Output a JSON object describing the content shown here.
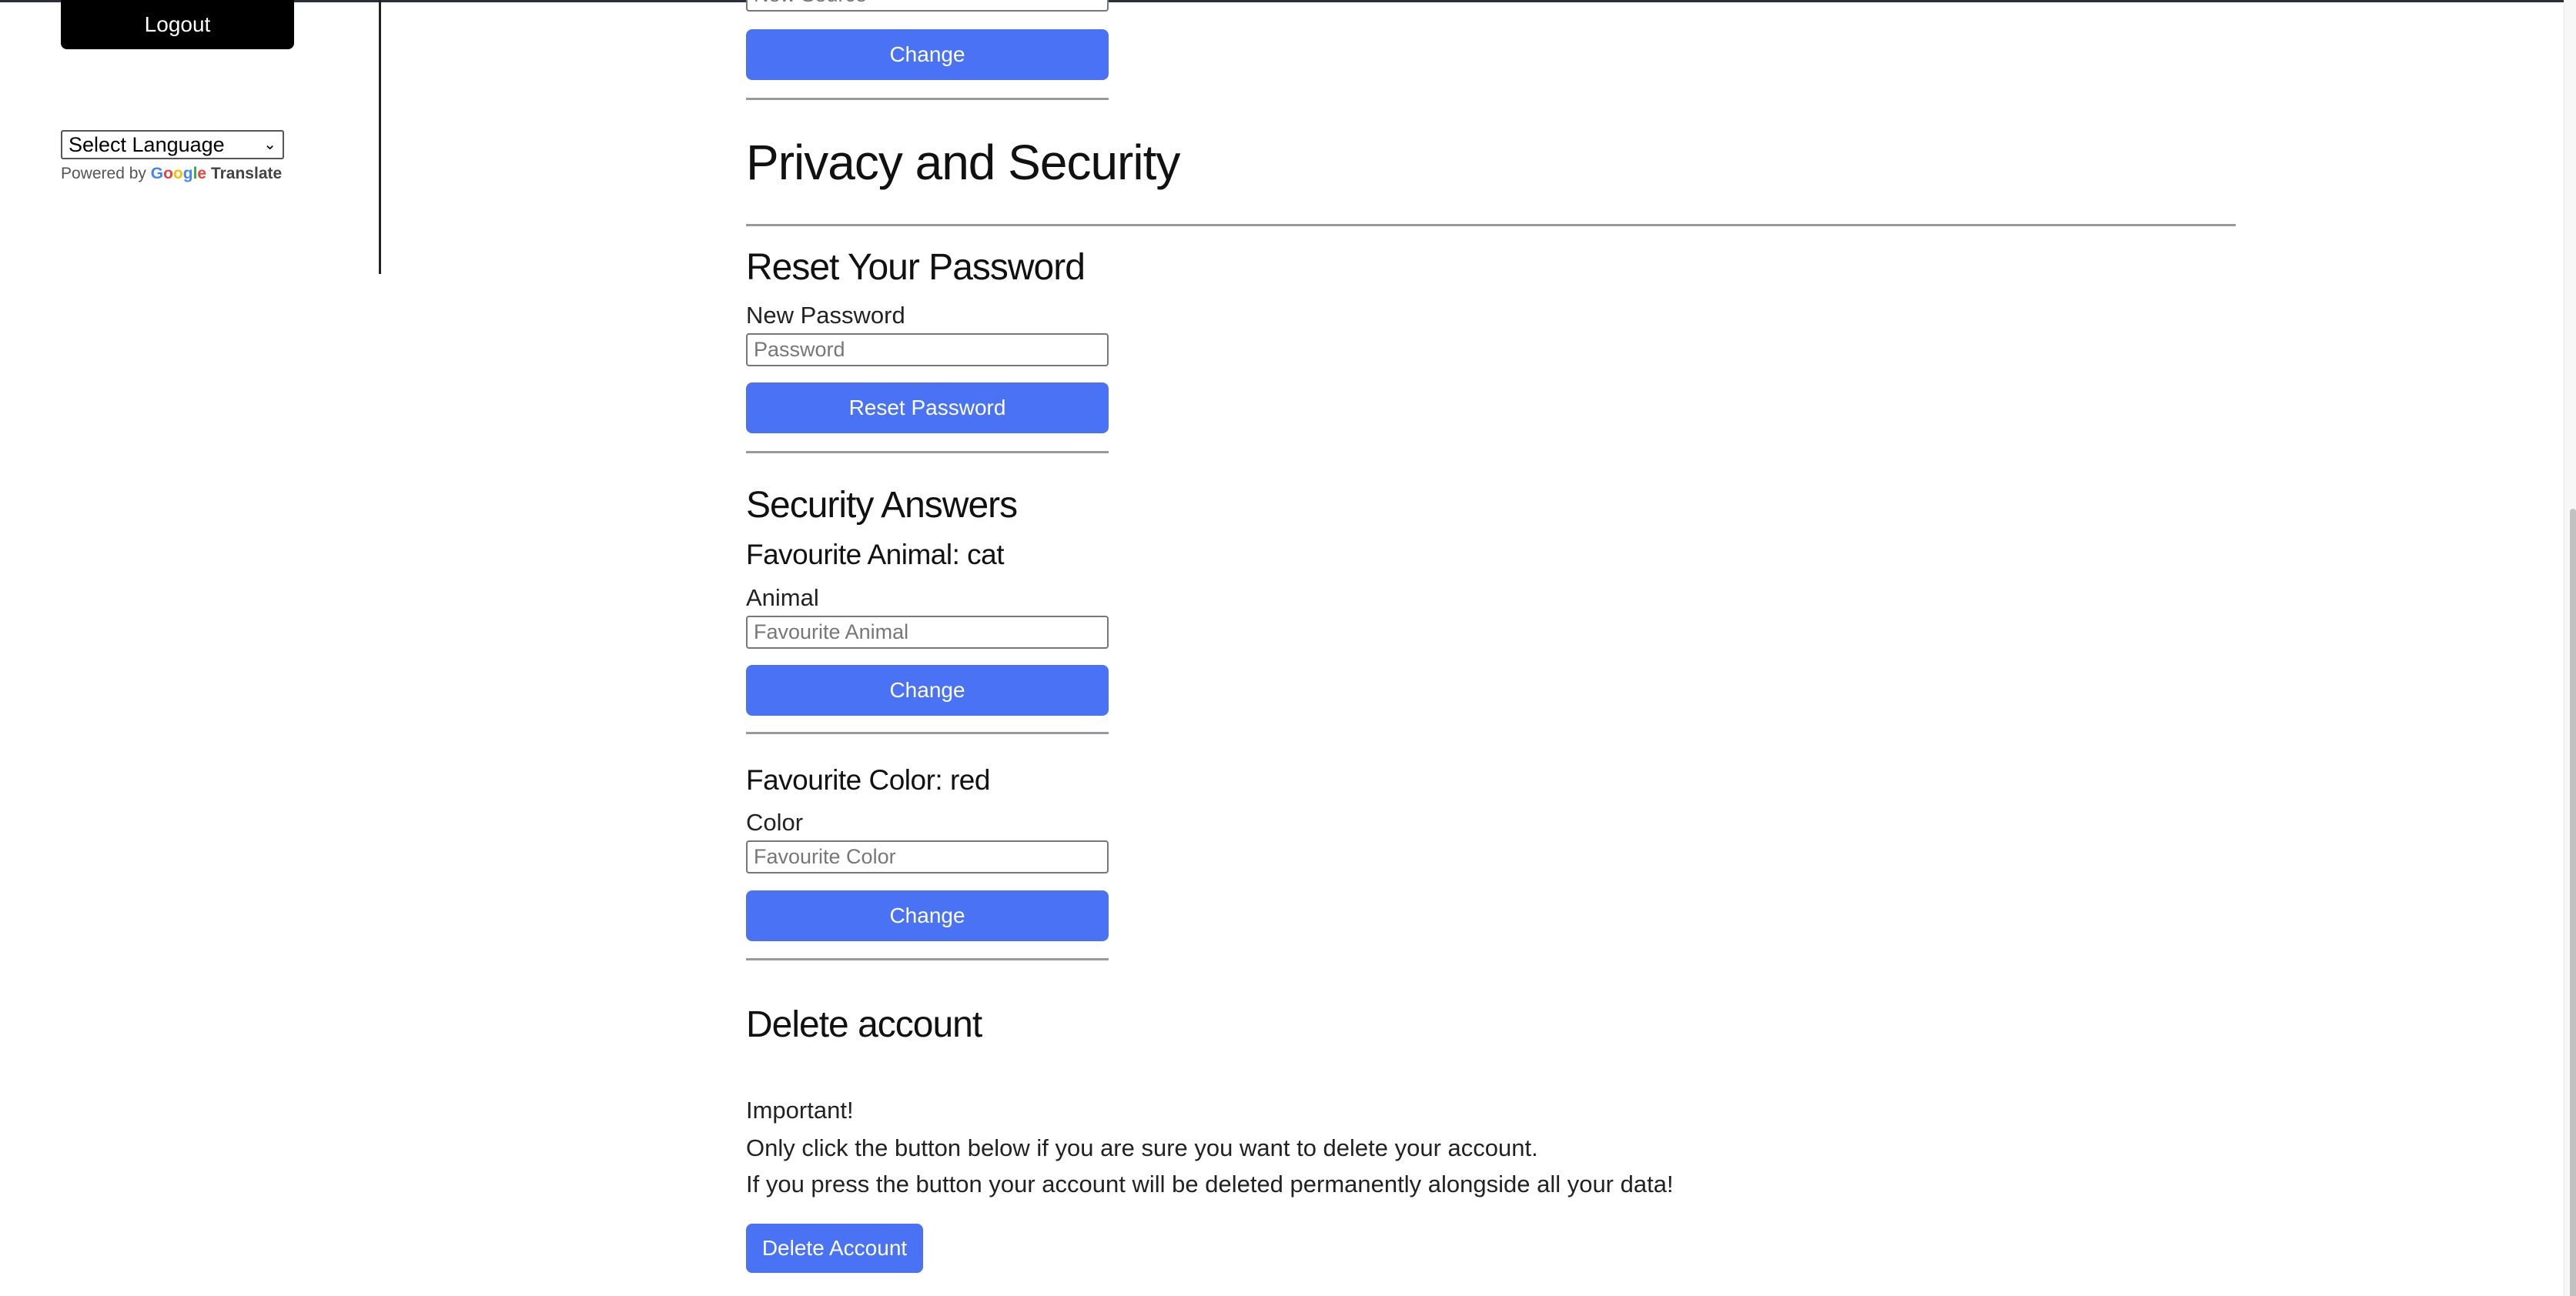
{
  "sidebar": {
    "logout_label": "Logout",
    "language_select": "Select Language",
    "powered_by": "Powered by",
    "google": "Google",
    "translate": "Translate"
  },
  "top": {
    "input_placeholder": "New Source",
    "change_label": "Change"
  },
  "privacy": {
    "title": "Privacy and Security",
    "reset": {
      "title": "Reset Your Password",
      "label": "New Password",
      "placeholder": "Password",
      "button": "Reset Password"
    },
    "security": {
      "title": "Security Answers",
      "animal": {
        "current": "Favourite Animal: cat",
        "label": "Animal",
        "placeholder": "Favourite Animal",
        "button": "Change"
      },
      "color": {
        "current": "Favourite Color: red",
        "label": "Color",
        "placeholder": "Favourite Color",
        "button": "Change"
      }
    },
    "delete": {
      "title": "Delete account",
      "line1": "Important!",
      "line2": "Only click the button below if you are sure you want to delete your account.",
      "line3": "If you press the button your account will be deleted permanently alongside all your data!",
      "button": "Delete Account"
    }
  },
  "colors": {
    "accent": "#4a72f5",
    "logout_bg": "#000000"
  }
}
